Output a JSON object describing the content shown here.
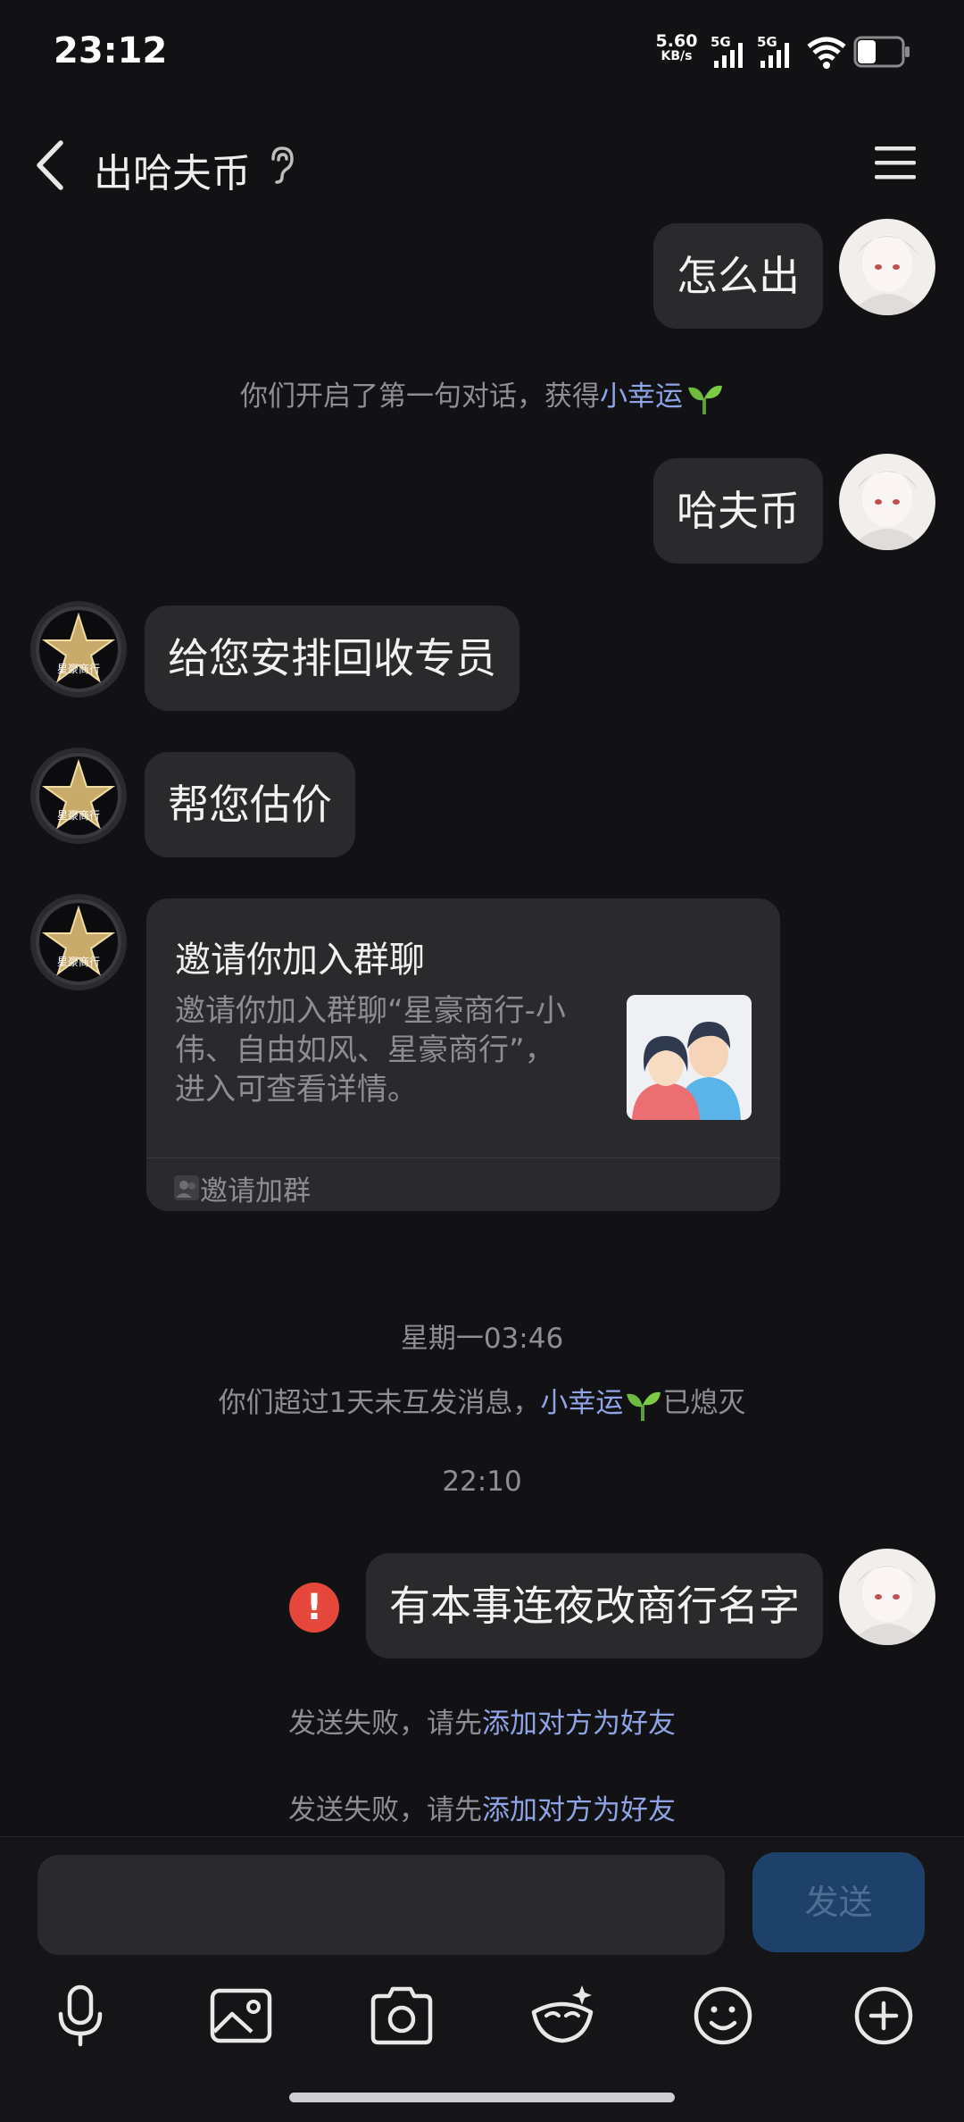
{
  "status_bar": {
    "time": "23:12",
    "net_speed_value": "5.60",
    "net_speed_unit": "KB/s",
    "signal_1": "5G",
    "signal_2": "5G"
  },
  "header": {
    "title": "出哈夫币",
    "back_icon": "back-chevron-icon",
    "ear_icon": "ear-icon",
    "menu_icon": "hamburger-menu-icon"
  },
  "messages": {
    "m1": "怎么出",
    "sys1_prefix": "你们开启了第一句对话，获得",
    "sys1_link": "小幸运",
    "m2": "哈夫币",
    "m3": "给您安排回收专员",
    "m4": "帮您估价",
    "card": {
      "title": "邀请你加入群聊",
      "description": "邀请你加入群聊“星豪商行-小伟、自由如风、星豪商行”，进入可查看详情。",
      "footer": "邀请加群"
    },
    "ts1": "星期一03:46",
    "sys2_prefix": "你们超过1天未互发消息，",
    "sys2_link": "小幸运",
    "sys2_suffix": "已熄灭",
    "ts2": "22:10",
    "m5": "有本事连夜改商行名字",
    "fail_prefix": "发送失败，请先",
    "fail_link": "添加对方为好友"
  },
  "input": {
    "placeholder": "",
    "send_label": "发送"
  },
  "other_avatar_badge": "星豪商行",
  "colors": {
    "background": "#121215",
    "bubble": "#2a2a2d",
    "link": "#8fa4e6",
    "error": "#e5483b",
    "send_button": "#1d4168"
  }
}
